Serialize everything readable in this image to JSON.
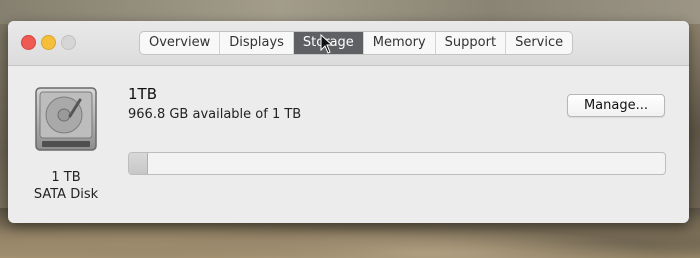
{
  "window": {
    "tabs": [
      {
        "label": "Overview",
        "active": false
      },
      {
        "label": "Displays",
        "active": false
      },
      {
        "label": "Storage",
        "active": true
      },
      {
        "label": "Memory",
        "active": false
      },
      {
        "label": "Support",
        "active": false
      },
      {
        "label": "Service",
        "active": false
      }
    ]
  },
  "disk": {
    "icon": "hard-drive-icon",
    "caption_size": "1 TB",
    "caption_type": "SATA Disk",
    "name": "1TB",
    "available_text": "966.8 GB available of 1 TB",
    "used_fraction": 0.034
  },
  "actions": {
    "manage_label": "Manage..."
  },
  "colors": {
    "close": "#ef5a52",
    "minimize": "#f5be3b",
    "active_tab": "#5e6063"
  }
}
